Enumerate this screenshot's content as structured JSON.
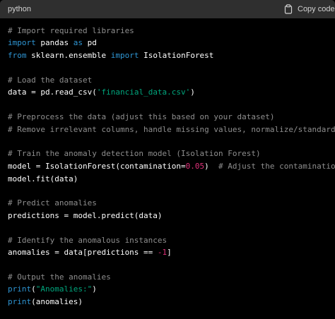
{
  "header": {
    "language": "python",
    "copy_label": "Copy code",
    "copy_icon": "clipboard-icon"
  },
  "colors": {
    "background": "#000000",
    "header_background": "#2f2f2f",
    "comment": "#8e8e8e",
    "keyword": "#2e95d3",
    "string": "#00a67d",
    "number": "#df3079",
    "text": "#ffffff"
  },
  "code": {
    "comment_import": "# Import required libraries",
    "kw_import_1": "import",
    "t_pandas": " pandas ",
    "kw_as": "as",
    "t_pd": " pd",
    "kw_from": "from",
    "t_sklearn": " sklearn.ensemble ",
    "kw_import_2": "import",
    "t_iforest": " IsolationForest",
    "comment_load": "# Load the dataset",
    "t_read_csv": "data = pd.read_csv(",
    "str_file": "'financial_data.csv'",
    "t_close_1": ")",
    "comment_preprocess": "# Preprocess the data (adjust this based on your dataset)",
    "comment_remove": "# Remove irrelevant columns, handle missing values, normalize/standardize data, etc.",
    "comment_train": "# Train the anomaly detection model (Isolation Forest)",
    "t_model_assign": "model = IsolationForest(contamination=",
    "num_contamination": "0.05",
    "t_close_2": ")  ",
    "comment_adjust": "# Adjust the contamination parameter as needed",
    "t_model_fit": "model.fit(data)",
    "comment_predict": "# Predict anomalies",
    "t_predictions": "predictions = model.predict(data)",
    "comment_identify": "# Identify the anomalous instances",
    "t_anomalies_assign": "anomalies = data[predictions == ",
    "num_neg_one": "-1",
    "t_close_3": "]",
    "comment_output": "# Output the anomalies",
    "kw_print_1": "print",
    "t_open_1": "(",
    "str_anomalies": "\"Anomalies:\"",
    "t_close_4": ")",
    "kw_print_2": "print",
    "t_print_args": "(anomalies)"
  }
}
